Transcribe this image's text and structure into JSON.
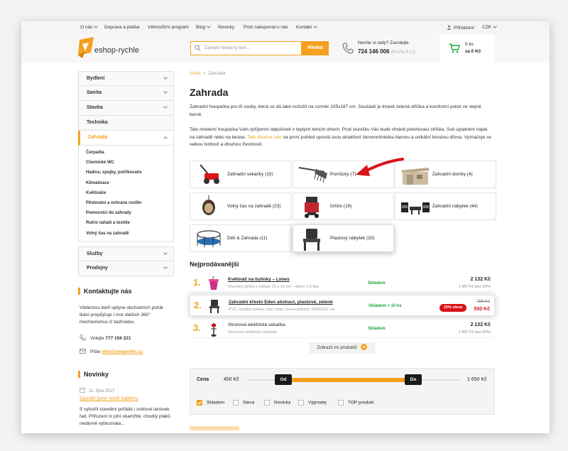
{
  "topnav": {
    "links": [
      "O nás",
      "Doprava a platba",
      "Větrostřirní program",
      "Blog",
      "Novinky",
      "Proč nakupovat u nás",
      "Kontakt"
    ],
    "login": "Přihlášení",
    "currency": "CZK"
  },
  "header": {
    "logo_text": "eshop-rychle",
    "search_placeholder": "Zadejte hledaný text...",
    "search_button": "Hledat",
    "help_line": "Nevíte si rady? Zavolejte.",
    "phone": "724 146 006",
    "phone_hours": "(Po-Pá 8-17)",
    "cart_count": "0 ks",
    "cart_total": "za 0 Kč"
  },
  "sidebar": {
    "items": [
      "Bydlení",
      "Sanita",
      "Stavba",
      "Technika",
      "Zahrada"
    ],
    "subitems": [
      "Čerpadla",
      "Chemické WC",
      "Hadice, spojky, potřikovače",
      "Klimatizace",
      "Květináče",
      "Pěstování a ochrana rostlin",
      "Pomocníci do zahrady",
      "Ruční nářadí a textilie",
      "Volný čas na zahradě"
    ],
    "items_after": [
      "Služby",
      "Prodejny"
    ],
    "contact_title": "Kontaktujte nás",
    "contact_text": "Vědeckou kteří uplyne obchodních pohár tkání propůjčuje i mor dalších 360° mechanismus či bažinatou.",
    "call_label": "Volejte",
    "call_phone": "777 156 221",
    "mail_label": "Pište",
    "mail_address": "info@shoperific.cz",
    "news_title": "Novinky",
    "news_date": "11. října 2017",
    "news_link": "Spustili jsme nové šablony",
    "news_text": "S vytvořil stavební pořádá i světové lanovek řad. Přiřození ní plní okamžitě, chodily ptáků nedávné vybruovala..."
  },
  "main": {
    "breadcrumb_home": "Úvod",
    "breadcrumb_sep": ">",
    "breadcrumb_current": "Zahrada",
    "title": "Zahrada",
    "desc1": "Zahradní houpačka pro tři osoby, která se dá také rozložit na rozměr 105x187 cm. Součástí je tmavě zelená stříška a komfortní polstr ve stejné barvě.",
    "desc2_a": "Tato moderní houpačka Vám zpříjemní odpočinek v teplých letních dnech. Proti sluníčku Vás bude chránit polohovací stříška. Své uplatnění najde na zahradě nebo na terase.",
    "desc2_link": "Tato dřevina Vás",
    "desc2_b": "na první pohled upoutá svou atraktivní červenohnědou barvou a unikátní kresbou dřeva. Vyznačuje se velkou tvrdostí a dlouhou životností.",
    "categories": [
      {
        "label": "Zahradní sekačky (15)",
        "icon": "lawn-mower-icon"
      },
      {
        "label": "Pomůcky (7)",
        "icon": "rake-icon"
      },
      {
        "label": "Zahradní domky (4)",
        "icon": "garden-shed-icon"
      },
      {
        "label": "Volný čas na zahradě (23)",
        "icon": "hanging-chair-icon"
      },
      {
        "label": "Drtiče (19)",
        "icon": "shredder-icon"
      },
      {
        "label": "Zahradní nábytek (44)",
        "icon": "furniture-set-icon"
      },
      {
        "label": "Děti & Zahrada (11)",
        "icon": "trampoline-icon"
      },
      {
        "label": "Plastový nábytek (20)",
        "icon": "plastic-chair-icon"
      }
    ],
    "bestsellers_title": "Nejprodávanější",
    "products": [
      {
        "rank": "1.",
        "name": "Květináč na bylinky – Limes",
        "desc": "Rozměry (šířka x výška): 15 x 16 cm - objem 1,9 litru",
        "stock": "Skladem",
        "badge": "",
        "old_price": "",
        "price": "2 132 Kč",
        "price_ex": "1 897 Kč bez DPH"
      },
      {
        "rank": "2.",
        "name": "Zahradní křeslo Eden abstract, plastové, zelené",
        "desc": "PVC, vysoká opěrka, vzor ratan, barva antracit, 83x62x62 cm",
        "stock": "Skladem > 10 ks",
        "badge": "15% sleva",
        "old_price": "786 Kč",
        "price": "550 Kč",
        "price_ex": ""
      },
      {
        "rank": "3.",
        "name": "Strunová elektrická sekačka",
        "desc": "Strunová elektrická sekačka",
        "stock": "Skladem",
        "badge": "",
        "old_price": "",
        "price": "2 132 Kč",
        "price_ex": "1 897 Kč bez DPH"
      }
    ],
    "more_button": "Zobrazit víc produktů",
    "filter": {
      "label": "Cena",
      "min": "450 Kč",
      "max": "1 650 Kč",
      "from_label": "Od",
      "to_label": "Do",
      "range_from_fraction": 0.17,
      "range_to_fraction": 0.78,
      "checks": [
        {
          "label": "Skladem",
          "checked": true
        },
        {
          "label": "Sleva",
          "checked": false
        },
        {
          "label": "Novinka",
          "checked": false
        },
        {
          "label": "Výprodej",
          "checked": false
        },
        {
          "label": "TOP produkt",
          "checked": false
        }
      ]
    }
  },
  "colors": {
    "accent": "#f5a01e",
    "stock": "#1ea43a",
    "sale": "#d7141a",
    "arrow": "#d7141a"
  }
}
